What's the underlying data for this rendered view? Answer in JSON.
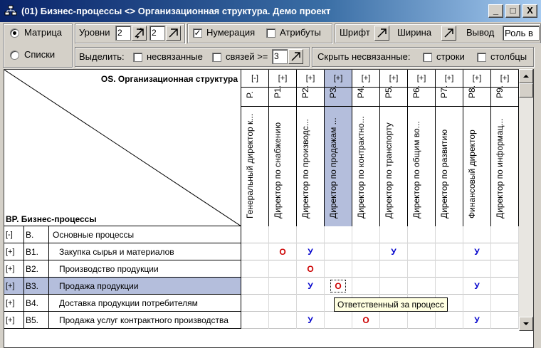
{
  "window": {
    "title": "(01) Бизнес-процессы <> Организационная структура. Демо проект",
    "buttons": {
      "minimize": "_",
      "maximize": "□",
      "close": "X"
    }
  },
  "toolbar": {
    "view_mode": {
      "matrix": "Матрица",
      "lists": "Списки",
      "selected": "matrix"
    },
    "levels_label": "Уровни",
    "levels_row": "2",
    "levels_col": "2",
    "numbering_label": "Нумерация",
    "numbering_checked": true,
    "attributes_label": "Атрибуты",
    "attributes_checked": false,
    "font_label": "Шрифт",
    "width_label": "Ширина",
    "output_label": "Вывод",
    "output_value": "Роль в",
    "highlight_label": "Выделить:",
    "unlinked_label": "несвязанные",
    "links_label": "связей >=",
    "links_value": "3",
    "hide_unlinked_label": "Скрыть несвязанные:",
    "rows_label": "строки",
    "cols_label": "столбцы"
  },
  "matrix": {
    "corner_top": "OS. Организационная структура",
    "corner_bottom": "BP. Бизнес-процессы",
    "columns": [
      {
        "toggle": "[-]",
        "code": "P.",
        "name": "Генеральный директор к..."
      },
      {
        "toggle": "[+]",
        "code": "P1.",
        "name": "Директор по снабжению"
      },
      {
        "toggle": "[+]",
        "code": "P2.",
        "name": "Директор по производс..."
      },
      {
        "toggle": "[+]",
        "code": "P3.",
        "name": "Директор по продажам ..."
      },
      {
        "toggle": "[+]",
        "code": "P4.",
        "name": "Директор по контрактно..."
      },
      {
        "toggle": "[+]",
        "code": "P5.",
        "name": "Директор по транспорту"
      },
      {
        "toggle": "[+]",
        "code": "P6.",
        "name": "Директор по общим во..."
      },
      {
        "toggle": "[+]",
        "code": "P7.",
        "name": "Директор по развитию"
      },
      {
        "toggle": "[+]",
        "code": "P8.",
        "name": "Финансовый директор"
      },
      {
        "toggle": "[+]",
        "code": "P9.",
        "name": "Директор по информац..."
      }
    ],
    "rows": [
      {
        "toggle": "[-]",
        "code": "B.",
        "name": "Основные процессы",
        "cells": [
          "",
          "",
          "",
          "",
          "",
          "",
          "",
          "",
          "",
          ""
        ]
      },
      {
        "toggle": "[+]",
        "code": "B1.",
        "name": "Закупка сырья и материалов",
        "cells": [
          "",
          "О",
          "У",
          "",
          "",
          "У",
          "",
          "",
          "У",
          ""
        ]
      },
      {
        "toggle": "[+]",
        "code": "B2.",
        "name": "Производство продукции",
        "cells": [
          "",
          "",
          "О",
          "",
          "",
          "",
          "",
          "",
          "",
          ""
        ]
      },
      {
        "toggle": "[+]",
        "code": "B3.",
        "name": "Продажа продукции",
        "cells": [
          "",
          "",
          "У",
          "О",
          "",
          "",
          "",
          "",
          "У",
          ""
        ]
      },
      {
        "toggle": "[+]",
        "code": "B4.",
        "name": "Доставка продукции потребителям",
        "cells": [
          "",
          "",
          "",
          "",
          "",
          "",
          "",
          "",
          "",
          ""
        ]
      },
      {
        "toggle": "[+]",
        "code": "B5.",
        "name": "Продажа услуг контрактного производства",
        "cells": [
          "",
          "",
          "У",
          "",
          "О",
          "",
          "",
          "",
          "У",
          ""
        ]
      }
    ],
    "selected_column": 3,
    "selected_row": 3,
    "tooltip": "Ответственный за процесс"
  },
  "colors": {
    "title_start": "#0a246a",
    "title_end": "#a6caf0",
    "selection": "#b4bedc",
    "owner_mark": "#cc0000",
    "participant_mark": "#0000cc"
  }
}
